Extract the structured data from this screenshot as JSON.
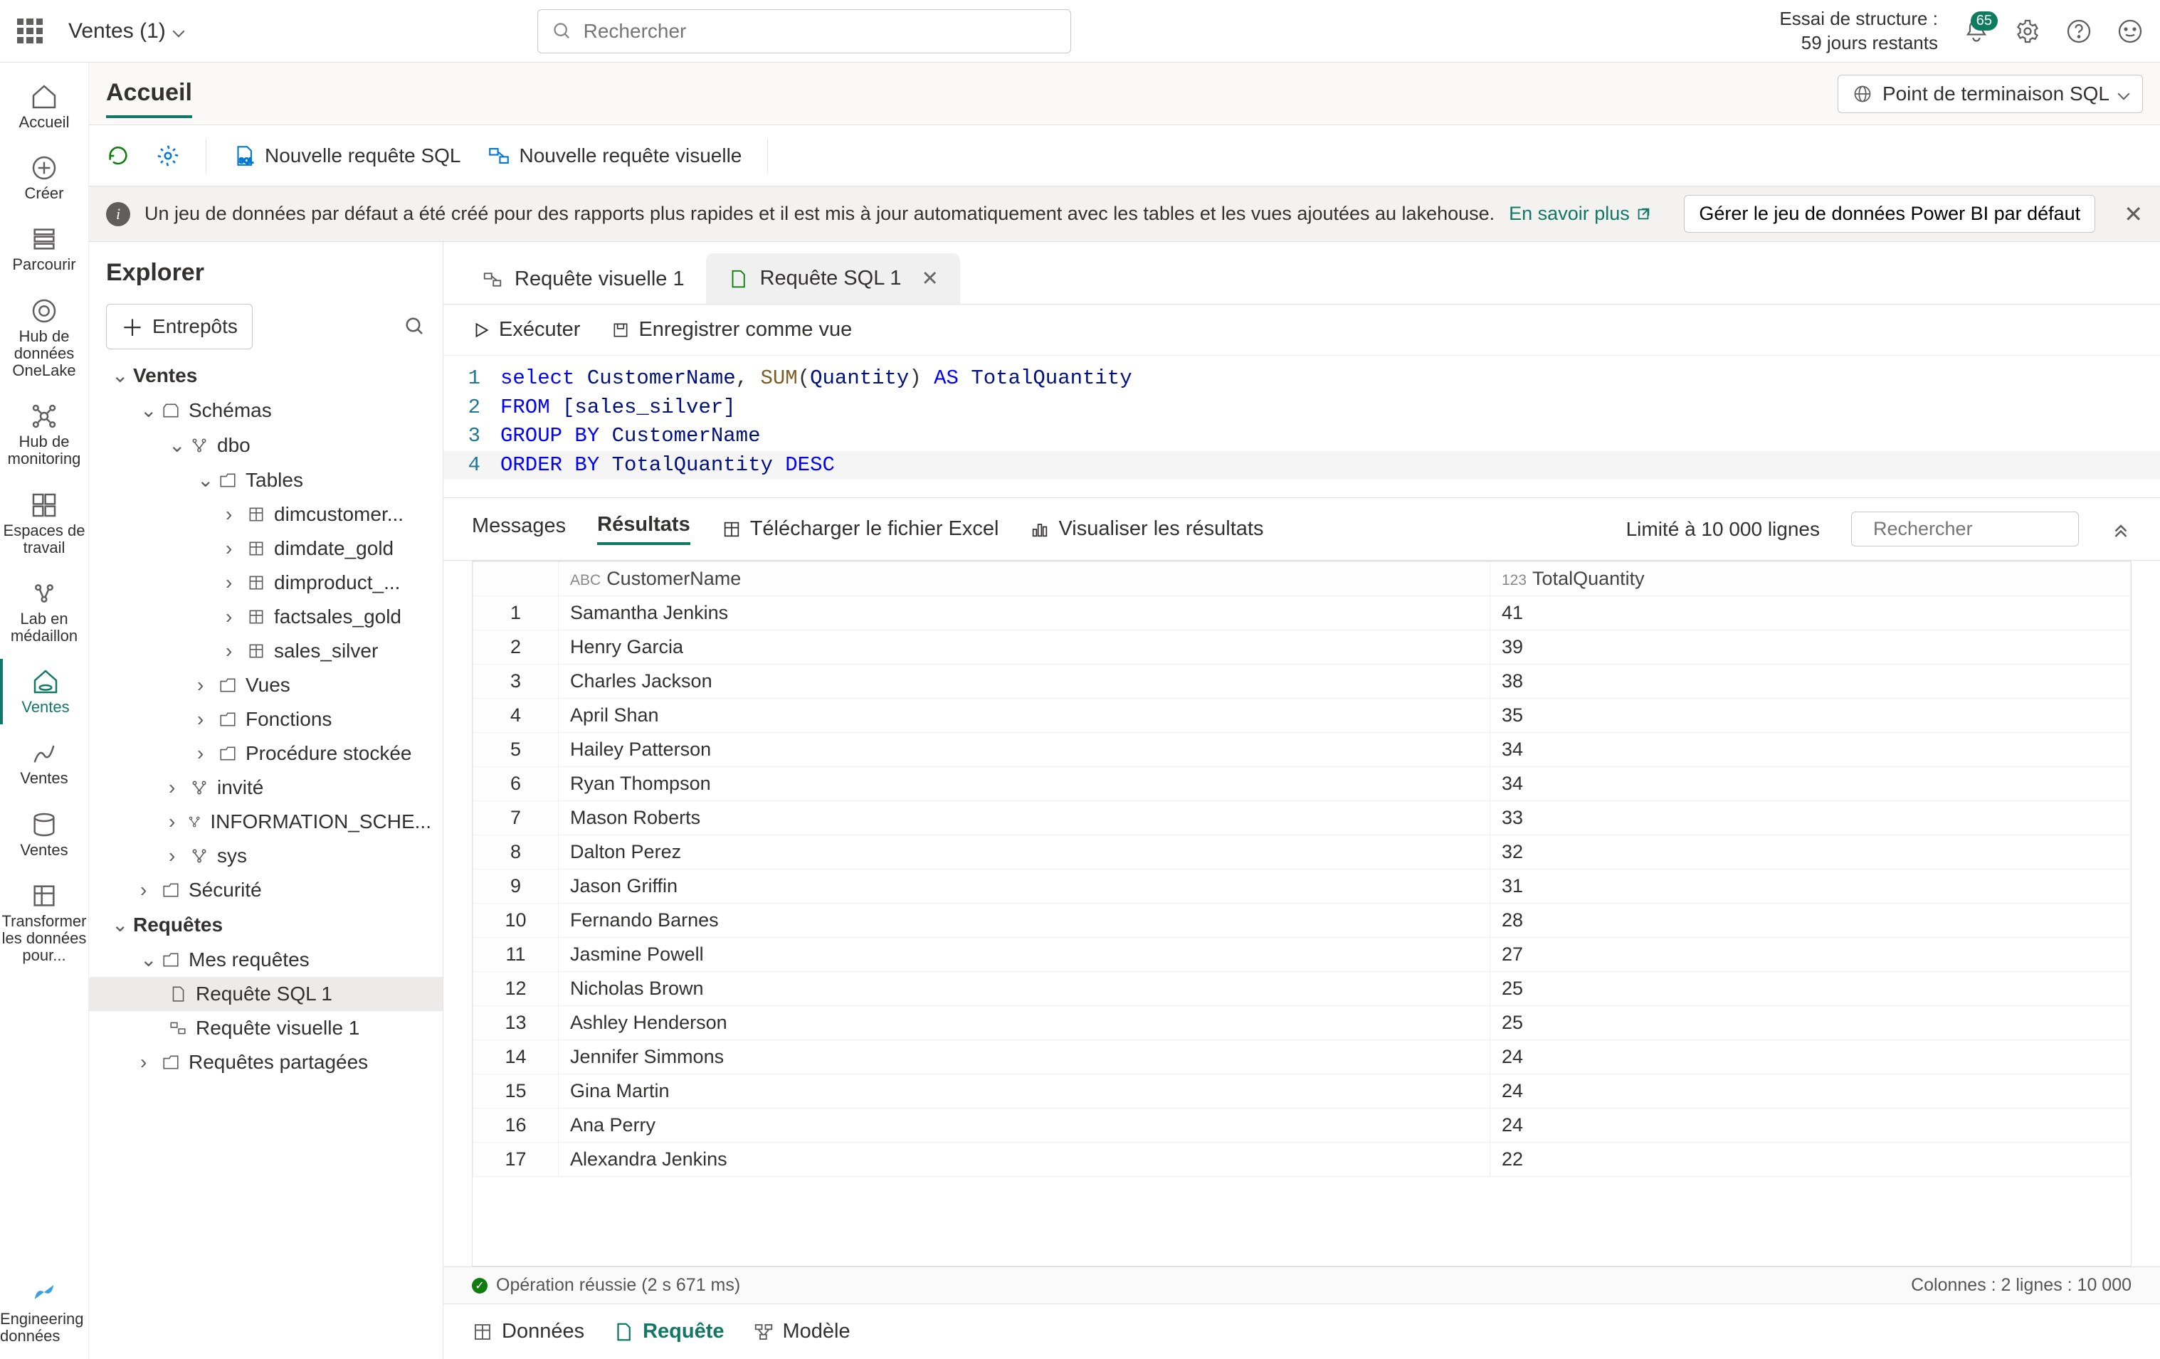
{
  "header": {
    "workspace_name": "Ventes (1)",
    "search_placeholder": "Rechercher",
    "trial_line1": "Essai de structure :",
    "trial_line2": "59 jours restants",
    "notif_count": "65"
  },
  "left_rail": {
    "home": "Accueil",
    "create": "Créer",
    "browse": "Parcourir",
    "onelake": "Hub de données OneLake",
    "monitoring": "Hub de monitoring",
    "workspaces": "Espaces de travail",
    "medallion": "Lab en médaillon",
    "ventes": "Ventes",
    "ventes2": "Ventes",
    "ventes3": "Ventes",
    "transform": "Transformer les données pour...",
    "brand": "Engineering données"
  },
  "page": {
    "title": "Accueil",
    "endpoint_btn": "Point de terminaison SQL"
  },
  "toolbar": {
    "new_sql_query": "Nouvelle requête SQL",
    "new_visual_query": "Nouvelle requête visuelle"
  },
  "banner": {
    "text": "Un jeu de données par défaut a été créé pour des rapports plus rapides et il est mis à jour automatiquement avec les tables et les vues ajoutées au lakehouse.",
    "link": "En savoir plus",
    "manage_btn": "Gérer le jeu de données Power BI par défaut"
  },
  "explorer": {
    "title": "Explorer",
    "warehouses_btn": "Entrepôts",
    "tree": {
      "ventes": "Ventes",
      "schemas": "Schémas",
      "dbo": "dbo",
      "tables": "Tables",
      "t1": "dimcustomer...",
      "t2": "dimdate_gold",
      "t3": "dimproduct_...",
      "t4": "factsales_gold",
      "t5": "sales_silver",
      "views": "Vues",
      "functions": "Fonctions",
      "stored_proc": "Procédure stockée",
      "guest": "invité",
      "info_schema": "INFORMATION_SCHE...",
      "sys": "sys",
      "security": "Sécurité",
      "queries": "Requêtes",
      "my_queries": "Mes requêtes",
      "sql_query1": "Requête SQL 1",
      "visual_query1": "Requête visuelle 1",
      "shared_queries": "Requêtes partagées"
    }
  },
  "tabs": {
    "tab1": "Requête visuelle 1",
    "tab2": "Requête SQL 1"
  },
  "editor_toolbar": {
    "run": "Exécuter",
    "save_view": "Enregistrer comme vue"
  },
  "sql": {
    "line1": {
      "select": "select",
      "cn": " CustomerName",
      "comma": ", ",
      "sum": "SUM",
      "op": "(",
      "q": "Quantity",
      "cp": ")",
      "as": " AS ",
      "tq": "TotalQuantity"
    },
    "line2": {
      "from": "FROM ",
      "tbl": "[sales_silver]"
    },
    "line3": {
      "groupby": "GROUP BY ",
      "cn": "CustomerName"
    },
    "line4": {
      "orderby": "ORDER BY ",
      "tq": "TotalQuantity ",
      "desc": "DESC"
    }
  },
  "results_toolbar": {
    "messages": "Messages",
    "results": "Résultats",
    "download": "Télécharger le fichier Excel",
    "visualize": "Visualiser les résultats",
    "limit": "Limité à 10 000 lignes",
    "search_placeholder": "Rechercher"
  },
  "grid_cols": {
    "col1": "CustomerName",
    "col2": "TotalQuantity",
    "col1_type": "ABC",
    "col2_type": "123"
  },
  "grid_rows": [
    [
      "1",
      "Samantha Jenkins",
      "41"
    ],
    [
      "2",
      "Henry Garcia",
      "39"
    ],
    [
      "3",
      "Charles Jackson",
      "38"
    ],
    [
      "4",
      "April Shan",
      "35"
    ],
    [
      "5",
      "Hailey Patterson",
      "34"
    ],
    [
      "6",
      "Ryan Thompson",
      "34"
    ],
    [
      "7",
      "Mason Roberts",
      "33"
    ],
    [
      "8",
      "Dalton Perez",
      "32"
    ],
    [
      "9",
      "Jason Griffin",
      "31"
    ],
    [
      "10",
      "Fernando Barnes",
      "28"
    ],
    [
      "11",
      "Jasmine Powell",
      "27"
    ],
    [
      "12",
      "Nicholas Brown",
      "25"
    ],
    [
      "13",
      "Ashley Henderson",
      "25"
    ],
    [
      "14",
      "Jennifer Simmons",
      "24"
    ],
    [
      "15",
      "Gina Martin",
      "24"
    ],
    [
      "16",
      "Ana Perry",
      "24"
    ],
    [
      "17",
      "Alexandra Jenkins",
      "22"
    ]
  ],
  "status": {
    "success": "Opération réussie (2 s 671 ms)",
    "columns": "Colonnes :  2 lignes :  10 000"
  },
  "bottom_tabs": {
    "data": "Données",
    "query": "Requête",
    "model": "Modèle"
  }
}
